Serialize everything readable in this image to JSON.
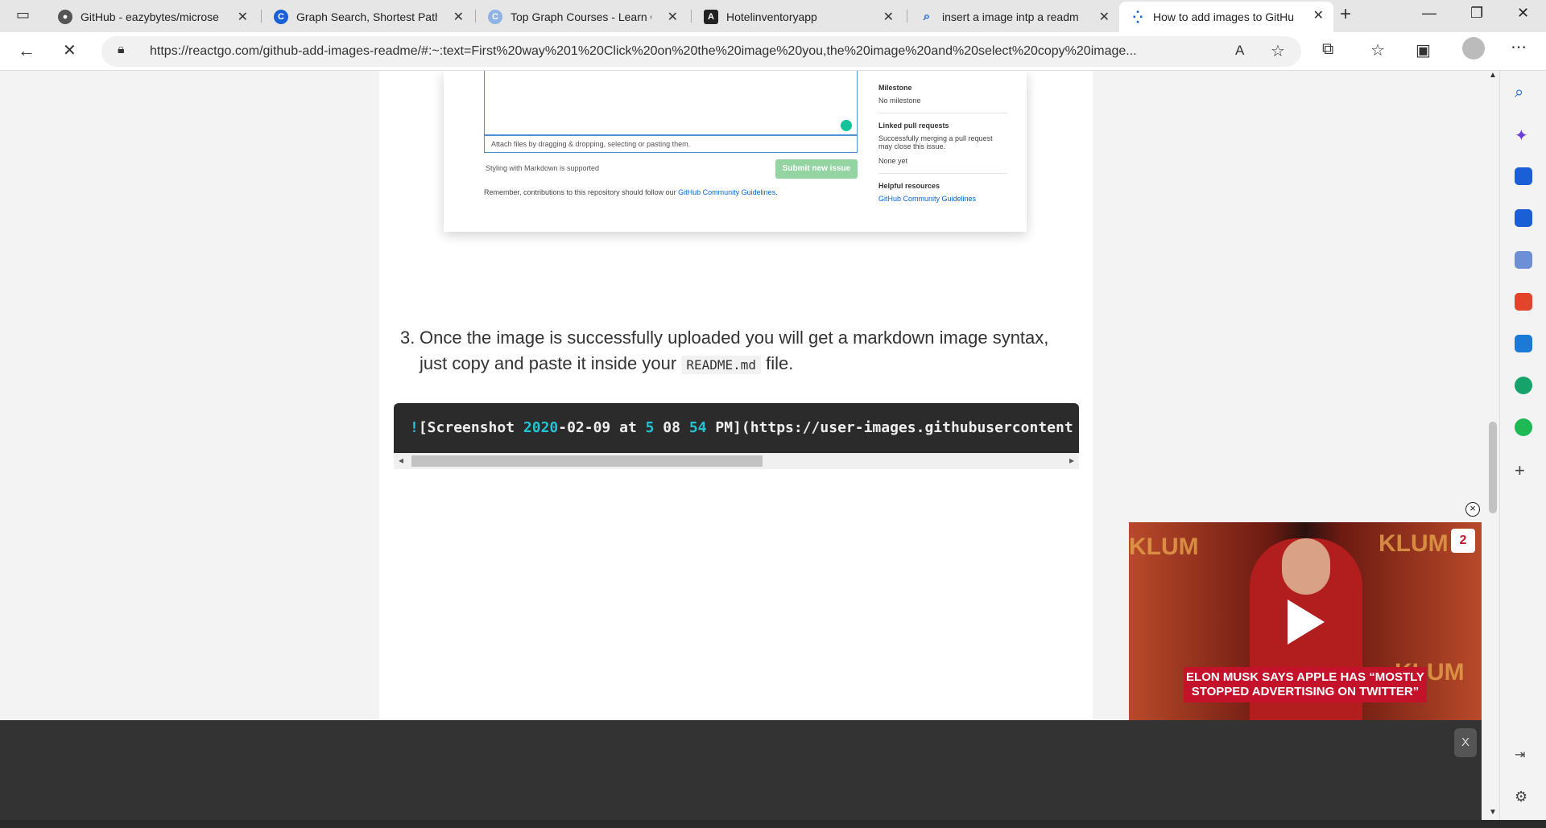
{
  "tabs": [
    {
      "title": "GitHub - eazybytes/microse",
      "favicon": "github-icon"
    },
    {
      "title": "Graph Search, Shortest Path",
      "favicon": "c-icon"
    },
    {
      "title": "Top Graph Courses - Learn G",
      "favicon": "c-icon"
    },
    {
      "title": "Hotelinventoryapp",
      "favicon": "angular-icon"
    },
    {
      "title": "insert a image intp a readm",
      "favicon": "search-icon"
    },
    {
      "title": "How to add images to GitHu",
      "favicon": "loading-icon"
    }
  ],
  "address": {
    "url": "https://reactgo.com/github-add-images-readme/#:~:text=First%20way%201%20Click%20on%20the%20image%20you,the%20image%20and%20select%20copy%20image..."
  },
  "screenshot": {
    "attach_text": "Attach files by dragging & dropping, selecting or pasting them.",
    "markdown_note": "Styling with Markdown is supported",
    "submit_label": "Submit new issue",
    "remember_text": "Remember, contributions to this repository should follow our",
    "remember_link": "GitHub Community Guidelines.",
    "side": {
      "milestone_h": "Milestone",
      "milestone_v": "No milestone",
      "linked_h": "Linked pull requests",
      "linked_v": "Successfully merging a pull request may close this issue.",
      "linked_none": "None yet",
      "helpful_h": "Helpful resources",
      "helpful_link": "GitHub Community Guidelines"
    }
  },
  "step": {
    "number": "3.",
    "text_before": "Once the image is successfully uploaded you will get a markdown image syntax, just copy and paste it inside your",
    "code": "README.md",
    "text_after": "file."
  },
  "code": {
    "p1": "!",
    "p2": "[Screenshot ",
    "p3": "2020",
    "p4": "-02-09 at ",
    "p5": "5",
    "p6": " 08 ",
    "p7": "54",
    "p8": " PM](https://user-images.githubusercontent"
  },
  "video": {
    "caption": "ELON MUSK SAYS APPLE HAS “MOSTLY STOPPED ADVERTISING ON TWITTER”",
    "logo": "2",
    "bg_text": "KLUM"
  },
  "ad": {
    "close_label": "X"
  }
}
